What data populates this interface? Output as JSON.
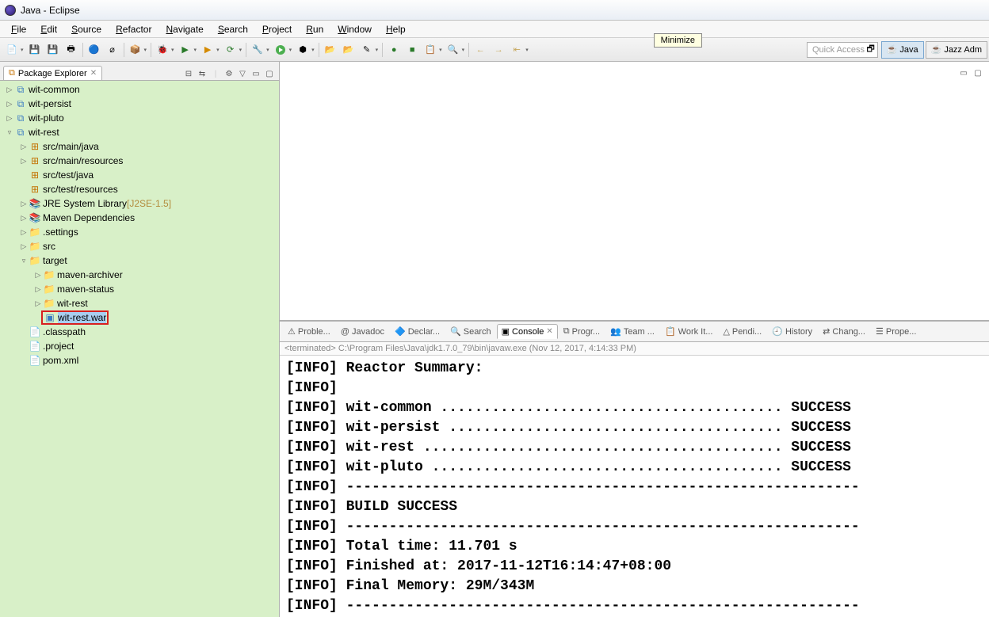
{
  "window": {
    "title": "Java - Eclipse"
  },
  "menu": [
    "File",
    "Edit",
    "Source",
    "Refactor",
    "Navigate",
    "Search",
    "Project",
    "Run",
    "Window",
    "Help"
  ],
  "tooltip": "Minimize",
  "quick_access_placeholder": "Quick Access",
  "perspectives": [
    {
      "label": "Java",
      "active": true
    },
    {
      "label": "Jazz Adm",
      "active": false
    }
  ],
  "package_explorer": {
    "tab_label": "Package Explorer",
    "tree": [
      {
        "depth": 0,
        "tw": "▷",
        "icon": "proj",
        "label": "wit-common"
      },
      {
        "depth": 0,
        "tw": "▷",
        "icon": "proj",
        "label": "wit-persist"
      },
      {
        "depth": 0,
        "tw": "▷",
        "icon": "proj",
        "label": "wit-pluto"
      },
      {
        "depth": 0,
        "tw": "▿",
        "icon": "proj",
        "label": "wit-rest"
      },
      {
        "depth": 1,
        "tw": "▷",
        "icon": "pkg",
        "label": "src/main/java"
      },
      {
        "depth": 1,
        "tw": "▷",
        "icon": "pkg",
        "label": "src/main/resources"
      },
      {
        "depth": 1,
        "tw": "",
        "icon": "pkg",
        "label": "src/test/java"
      },
      {
        "depth": 1,
        "tw": "",
        "icon": "pkg",
        "label": "src/test/resources"
      },
      {
        "depth": 1,
        "tw": "▷",
        "icon": "lib",
        "label": "JRE System Library",
        "decor": "[J2SE-1.5]"
      },
      {
        "depth": 1,
        "tw": "▷",
        "icon": "lib",
        "label": "Maven Dependencies"
      },
      {
        "depth": 1,
        "tw": "▷",
        "icon": "fld",
        "label": ".settings"
      },
      {
        "depth": 1,
        "tw": "▷",
        "icon": "fld",
        "label": "src"
      },
      {
        "depth": 1,
        "tw": "▿",
        "icon": "fld",
        "label": "target"
      },
      {
        "depth": 2,
        "tw": "▷",
        "icon": "fld",
        "label": "maven-archiver"
      },
      {
        "depth": 2,
        "tw": "▷",
        "icon": "fld",
        "label": "maven-status"
      },
      {
        "depth": 2,
        "tw": "▷",
        "icon": "fld",
        "label": "wit-rest"
      },
      {
        "depth": 2,
        "tw": "",
        "icon": "war",
        "label": "wit-rest.war",
        "highlight": true,
        "selected": true
      },
      {
        "depth": 1,
        "tw": "",
        "icon": "fil",
        "label": ".classpath"
      },
      {
        "depth": 1,
        "tw": "",
        "icon": "fil",
        "label": ".project"
      },
      {
        "depth": 1,
        "tw": "",
        "icon": "fil",
        "label": "pom.xml"
      }
    ]
  },
  "bottom_tabs": [
    {
      "label": "Proble...",
      "icon": "⚠"
    },
    {
      "label": "Javadoc",
      "icon": "@"
    },
    {
      "label": "Declar...",
      "icon": "🔷"
    },
    {
      "label": "Search",
      "icon": "🔍"
    },
    {
      "label": "Console",
      "icon": "▣",
      "active": true
    },
    {
      "label": "Progr...",
      "icon": "⧉"
    },
    {
      "label": "Team ...",
      "icon": "👥"
    },
    {
      "label": "Work It...",
      "icon": "📋"
    },
    {
      "label": "Pendi...",
      "icon": "△"
    },
    {
      "label": "History",
      "icon": "🕘"
    },
    {
      "label": "Chang...",
      "icon": "⇄"
    },
    {
      "label": "Prope...",
      "icon": "☰"
    }
  ],
  "console": {
    "terminated_line": "<terminated> C:\\Program Files\\Java\\jdk1.7.0_79\\bin\\javaw.exe (Nov 12, 2017, 4:14:33 PM)",
    "lines": [
      "[INFO] Reactor Summary:",
      "[INFO]",
      "[INFO] wit-common ........................................ SUCCESS",
      "[INFO] wit-persist ....................................... SUCCESS",
      "[INFO] wit-rest .......................................... SUCCESS",
      "[INFO] wit-pluto ......................................... SUCCESS",
      "[INFO] ------------------------------------------------------------",
      "[INFO] BUILD SUCCESS",
      "[INFO] ------------------------------------------------------------",
      "[INFO] Total time: 11.701 s",
      "[INFO] Finished at: 2017-11-12T16:14:47+08:00",
      "[INFO] Final Memory: 29M/343M",
      "[INFO] ------------------------------------------------------------"
    ]
  }
}
